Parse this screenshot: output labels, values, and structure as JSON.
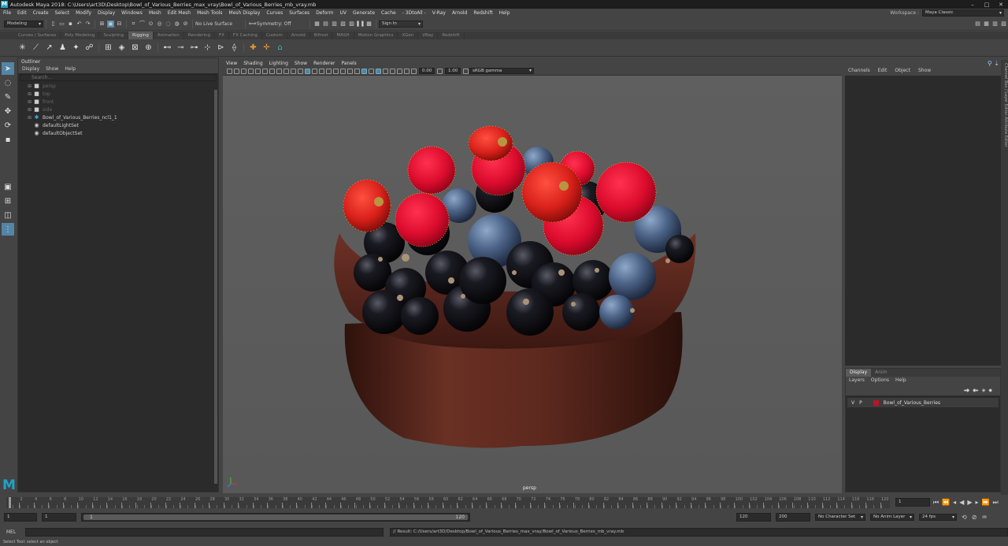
{
  "app": {
    "title": "Autodesk Maya 2018: C:\\Users\\art3D\\Desktop\\Bowl_of_Various_Berries_max_vray\\Bowl_of_Various_Berries_mb_vray.mb",
    "logo": "M"
  },
  "menubar": {
    "items": [
      "File",
      "Edit",
      "Create",
      "Select",
      "Modify",
      "Display",
      "Windows",
      "Mesh",
      "Edit Mesh",
      "Mesh Tools",
      "Mesh Display",
      "Curves",
      "Surfaces",
      "Deform",
      "UV",
      "Generate",
      "Cache",
      "- 3DtoAll -",
      "V-Ray",
      "Arnold",
      "Redshift",
      "Help"
    ],
    "workspace_label": "Workspace :",
    "workspace_value": "Maya Classic"
  },
  "statusline": {
    "mode": "Modeling",
    "live_surface": "No Live Surface",
    "symmetry": "Symmetry: Off",
    "sign_in": "Sign In"
  },
  "shelf_tabs": {
    "items": [
      "Curves / Surfaces",
      "Poly Modeling",
      "Sculpting",
      "Rigging",
      "Animation",
      "Rendering",
      "FX",
      "FX Caching",
      "Custom",
      "Arnold",
      "Bifrost",
      "MASH",
      "Motion Graphics",
      "XGen",
      "VRay",
      "Redshift"
    ],
    "active": "Rigging"
  },
  "outliner": {
    "title": "Outliner",
    "menus": [
      "Display",
      "Show",
      "Help"
    ],
    "search_placeholder": "Search...",
    "items": [
      {
        "label": "persp",
        "icon": "camera-icon",
        "dim": true
      },
      {
        "label": "top",
        "icon": "camera-icon",
        "dim": true
      },
      {
        "label": "front",
        "icon": "camera-icon",
        "dim": true
      },
      {
        "label": "side",
        "icon": "camera-icon",
        "dim": true
      },
      {
        "label": "Bowl_of_Various_Berries_ncl1_1",
        "icon": "group-icon",
        "dim": false
      },
      {
        "label": "defaultLightSet",
        "icon": "set-icon",
        "dim": false
      },
      {
        "label": "defaultObjectSet",
        "icon": "set-icon",
        "dim": false
      }
    ]
  },
  "viewport": {
    "menus": [
      "View",
      "Shading",
      "Lighting",
      "Show",
      "Renderer",
      "Panels"
    ],
    "exposure": "0.00",
    "gamma": "1.00",
    "color_space": "sRGB gamma",
    "camera": "persp"
  },
  "channelbox": {
    "menus": [
      "Channels",
      "Edit",
      "Object",
      "Show"
    ]
  },
  "sidetabs": "Channel Box / Layer Editor   Attribute Editor",
  "layers": {
    "tabs": [
      "Display",
      "Anim"
    ],
    "menus": [
      "Layers",
      "Options",
      "Help"
    ],
    "rows": [
      {
        "v": "V",
        "p": "P",
        "name": "Bowl_of_Various_Berries",
        "color": "#b8142a"
      }
    ]
  },
  "timeline": {
    "ticks": [
      "2",
      "4",
      "6",
      "8",
      "10",
      "12",
      "14",
      "16",
      "18",
      "20",
      "22",
      "24",
      "26",
      "28",
      "30",
      "32",
      "34",
      "36",
      "38",
      "40",
      "42",
      "44",
      "46",
      "48",
      "50",
      "52",
      "54",
      "56",
      "58",
      "60",
      "62",
      "64",
      "66",
      "68",
      "70",
      "72",
      "74",
      "76",
      "78",
      "80",
      "82",
      "84",
      "86",
      "88",
      "90",
      "92",
      "94",
      "96",
      "98",
      "100",
      "102",
      "104",
      "106",
      "108",
      "110",
      "112",
      "114",
      "116",
      "118",
      "120"
    ],
    "current_frame": "1"
  },
  "range": {
    "start": "1",
    "playback_start": "1",
    "slider_start": "1",
    "slider_end": "120",
    "playback_end": "120",
    "end": "200",
    "character_set": "No Character Set",
    "anim_layer": "No Anim Layer",
    "fps": "24 fps"
  },
  "cmdline": {
    "label": "MEL",
    "result": "// Result: C:/Users/art3D/Desktop/Bowl_of_Various_Berries_max_vray/Bowl_of_Various_Berries_mb_vray.mb"
  },
  "helpline": "Select Tool: select an object"
}
